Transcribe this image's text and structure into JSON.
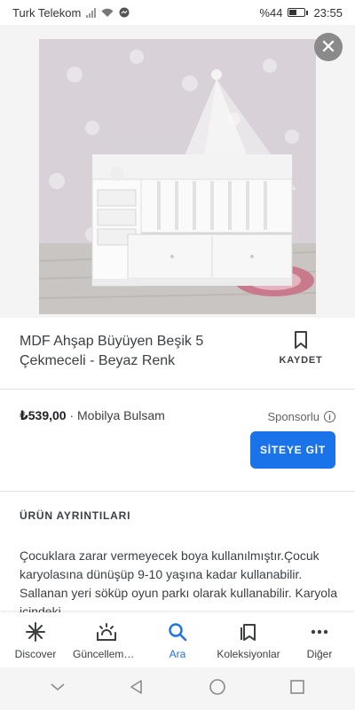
{
  "status_bar": {
    "carrier": "Turk Telekom",
    "battery": "%44",
    "time": "23:55"
  },
  "image": {
    "close_icon": "close-icon",
    "subject": "white baby crib with canopy"
  },
  "product": {
    "title": "MDF Ahşap Büyüyen Beşik 5 Çekmeceli - Beyaz Renk",
    "save_label": "KAYDET",
    "price": "₺539,00",
    "separator": " · ",
    "merchant": "Mobilya Bulsam",
    "sponsored": "Sponsorlu",
    "visit_label": "SİTEYE GİT"
  },
  "details": {
    "heading": "ÜRÜN AYRINTILARI",
    "text": "Çocuklara zarar vermeyecek boya kullanılmıştır.Çocuk karyolasına dünüşüp 9-10 yaşına kadar kullanabilir. Sallanan yeri söküp oyun parkı olarak kullanabilir. Karyola içindeki"
  },
  "bottom_nav": {
    "items": [
      {
        "label": "Discover",
        "icon": "asterisk-icon"
      },
      {
        "label": "Güncellemeler",
        "icon": "updates-icon"
      },
      {
        "label": "Ara",
        "icon": "search-icon"
      },
      {
        "label": "Koleksiyonlar",
        "icon": "collections-icon"
      },
      {
        "label": "Diğer",
        "icon": "more-icon"
      }
    ],
    "active_index": 2
  },
  "colors": {
    "accent": "#1a73e8",
    "text": "#3c4043"
  }
}
